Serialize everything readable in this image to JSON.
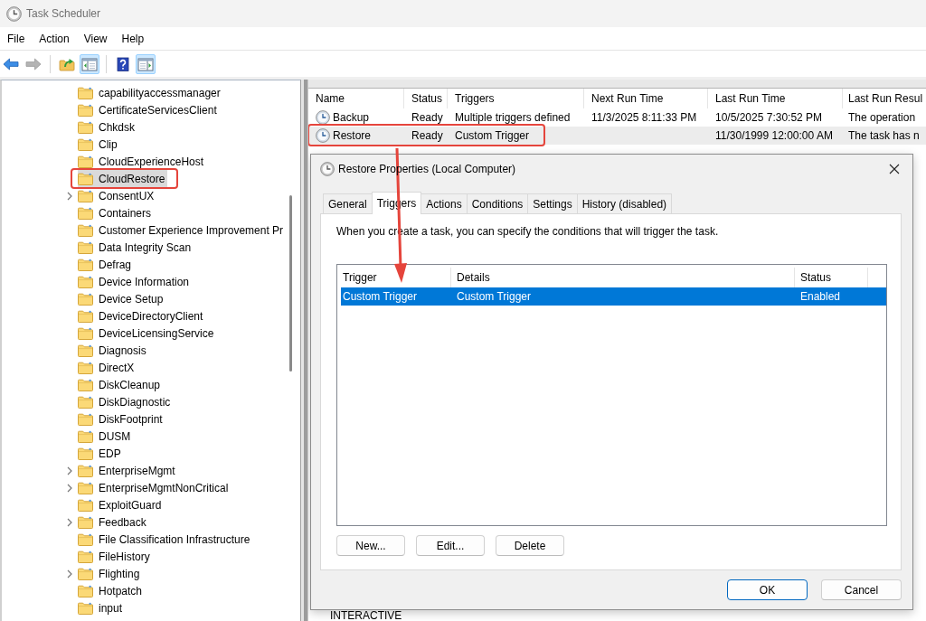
{
  "window": {
    "title": "Task Scheduler"
  },
  "menu": [
    "File",
    "Action",
    "View",
    "Help"
  ],
  "toolbar": [
    {
      "disabled": false,
      "pressed": false
    },
    {
      "disabled": true,
      "pressed": false
    },
    {
      "disabled": false,
      "pressed": false
    },
    {
      "disabled": false,
      "pressed": true
    },
    {
      "disabled": false,
      "pressed": false
    },
    {
      "disabled": false,
      "pressed": true
    }
  ],
  "tree": {
    "items": [
      {
        "label": "capabilityaccessmanager",
        "expandable": false,
        "selected": false,
        "annotated": false
      },
      {
        "label": "CertificateServicesClient",
        "expandable": false,
        "selected": false,
        "annotated": false
      },
      {
        "label": "Chkdsk",
        "expandable": false,
        "selected": false,
        "annotated": false
      },
      {
        "label": "Clip",
        "expandable": false,
        "selected": false,
        "annotated": false
      },
      {
        "label": "CloudExperienceHost",
        "expandable": false,
        "selected": false,
        "annotated": false
      },
      {
        "label": "CloudRestore",
        "expandable": false,
        "selected": true,
        "annotated": true
      },
      {
        "label": "ConsentUX",
        "expandable": true,
        "selected": false,
        "annotated": false
      },
      {
        "label": "Containers",
        "expandable": false,
        "selected": false,
        "annotated": false
      },
      {
        "label": "Customer Experience Improvement Pr",
        "expandable": false,
        "selected": false,
        "annotated": false
      },
      {
        "label": "Data Integrity Scan",
        "expandable": false,
        "selected": false,
        "annotated": false
      },
      {
        "label": "Defrag",
        "expandable": false,
        "selected": false,
        "annotated": false
      },
      {
        "label": "Device Information",
        "expandable": false,
        "selected": false,
        "annotated": false
      },
      {
        "label": "Device Setup",
        "expandable": false,
        "selected": false,
        "annotated": false
      },
      {
        "label": "DeviceDirectoryClient",
        "expandable": false,
        "selected": false,
        "annotated": false
      },
      {
        "label": "DeviceLicensingService",
        "expandable": false,
        "selected": false,
        "annotated": false
      },
      {
        "label": "Diagnosis",
        "expandable": false,
        "selected": false,
        "annotated": false
      },
      {
        "label": "DirectX",
        "expandable": false,
        "selected": false,
        "annotated": false
      },
      {
        "label": "DiskCleanup",
        "expandable": false,
        "selected": false,
        "annotated": false
      },
      {
        "label": "DiskDiagnostic",
        "expandable": false,
        "selected": false,
        "annotated": false
      },
      {
        "label": "DiskFootprint",
        "expandable": false,
        "selected": false,
        "annotated": false
      },
      {
        "label": "DUSM",
        "expandable": false,
        "selected": false,
        "annotated": false
      },
      {
        "label": "EDP",
        "expandable": false,
        "selected": false,
        "annotated": false
      },
      {
        "label": "EnterpriseMgmt",
        "expandable": true,
        "selected": false,
        "annotated": false
      },
      {
        "label": "EnterpriseMgmtNonCritical",
        "expandable": true,
        "selected": false,
        "annotated": false
      },
      {
        "label": "ExploitGuard",
        "expandable": false,
        "selected": false,
        "annotated": false
      },
      {
        "label": "Feedback",
        "expandable": true,
        "selected": false,
        "annotated": false
      },
      {
        "label": "File Classification Infrastructure",
        "expandable": false,
        "selected": false,
        "annotated": false
      },
      {
        "label": "FileHistory",
        "expandable": false,
        "selected": false,
        "annotated": false
      },
      {
        "label": "Flighting",
        "expandable": true,
        "selected": false,
        "annotated": false
      },
      {
        "label": "Hotpatch",
        "expandable": false,
        "selected": false,
        "annotated": false
      },
      {
        "label": "input",
        "expandable": false,
        "selected": false,
        "annotated": false
      }
    ]
  },
  "tasks": {
    "columns": [
      "Name",
      "Status",
      "Triggers",
      "Next Run Time",
      "Last Run Time",
      "Last Run Resul"
    ],
    "rows": [
      {
        "name": "Backup",
        "status": "Ready",
        "triggers": "Multiple triggers defined",
        "next_run_time": "11/3/2025 8:11:33 PM",
        "last_run_time": "10/5/2025 7:30:52 PM",
        "last_run_result": "The operation",
        "selected": false,
        "annotated": false
      },
      {
        "name": "Restore",
        "status": "Ready",
        "triggers": "Custom Trigger",
        "last_run_time": "11/30/1999 12:00:00 AM",
        "last_run_result": "The task has n",
        "selected": true,
        "annotated": true
      }
    ]
  },
  "dialog": {
    "title": "Restore Properties (Local Computer)",
    "tabs": [
      {
        "label": "General",
        "selected": false
      },
      {
        "label": "Triggers",
        "selected": true
      },
      {
        "label": "Actions",
        "selected": false
      },
      {
        "label": "Conditions",
        "selected": false
      },
      {
        "label": "Settings",
        "selected": false
      },
      {
        "label": "History (disabled)",
        "selected": false
      }
    ],
    "description": "When you create a task, you can specify the conditions that will trigger the task.",
    "trigger_list": {
      "columns": [
        "Trigger",
        "Details",
        "Status"
      ],
      "rows": [
        {
          "trigger": "Custom Trigger",
          "details": "Custom Trigger",
          "status": "Enabled",
          "selected": true
        }
      ]
    },
    "list_buttons": [
      "New...",
      "Edit...",
      "Delete"
    ],
    "buttons": [
      {
        "label": "OK",
        "default": true
      },
      {
        "label": "Cancel",
        "default": false
      }
    ]
  },
  "details_pane": {
    "text": "INTERACTIVE"
  }
}
